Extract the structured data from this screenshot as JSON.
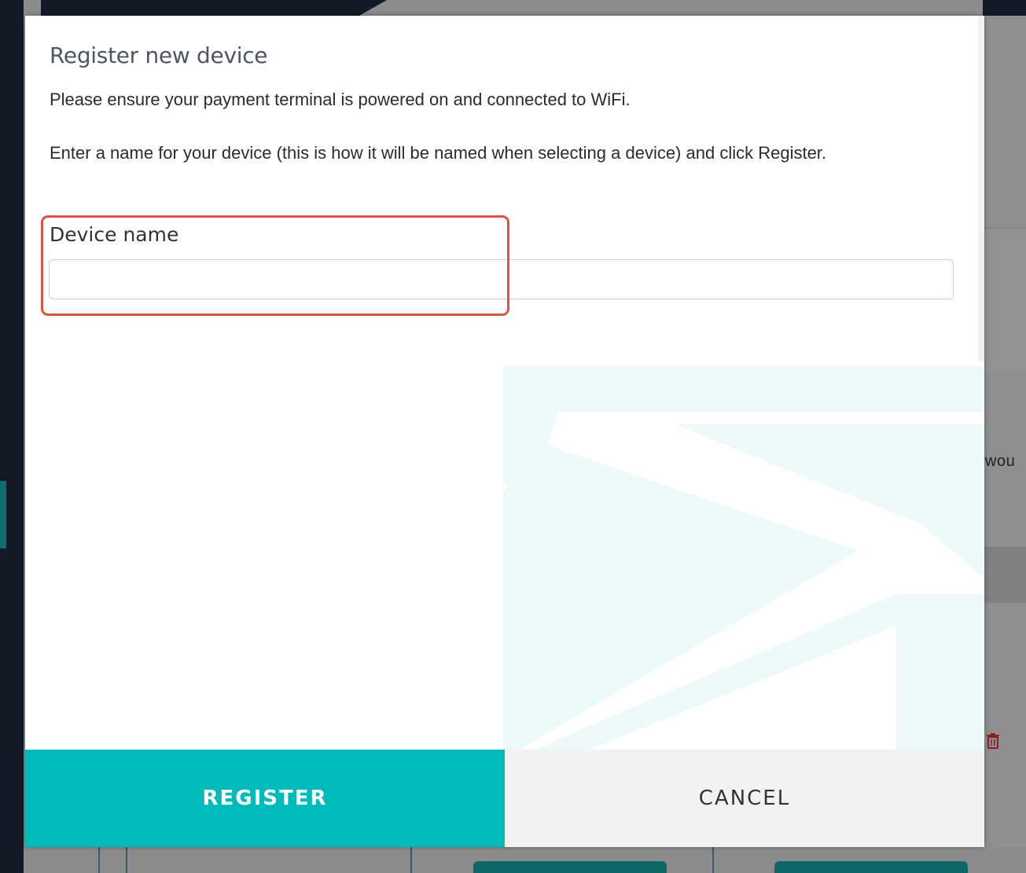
{
  "modal": {
    "title": "Register new device",
    "instruction_1": "Please ensure your payment terminal is powered on and connected to WiFi.",
    "instruction_2": "Enter a name for your device (this is how it will be named when selecting a device) and click Register.",
    "device_name_label": "Device name",
    "device_name_value": "",
    "register_label": "REGISTER",
    "cancel_label": "CANCEL"
  },
  "background": {
    "partial_text": "wou"
  },
  "colors": {
    "accent": "#00bbb9",
    "highlight": "#d9553f",
    "dark": "#141a25"
  },
  "icons": {
    "trash": "trash-icon"
  }
}
